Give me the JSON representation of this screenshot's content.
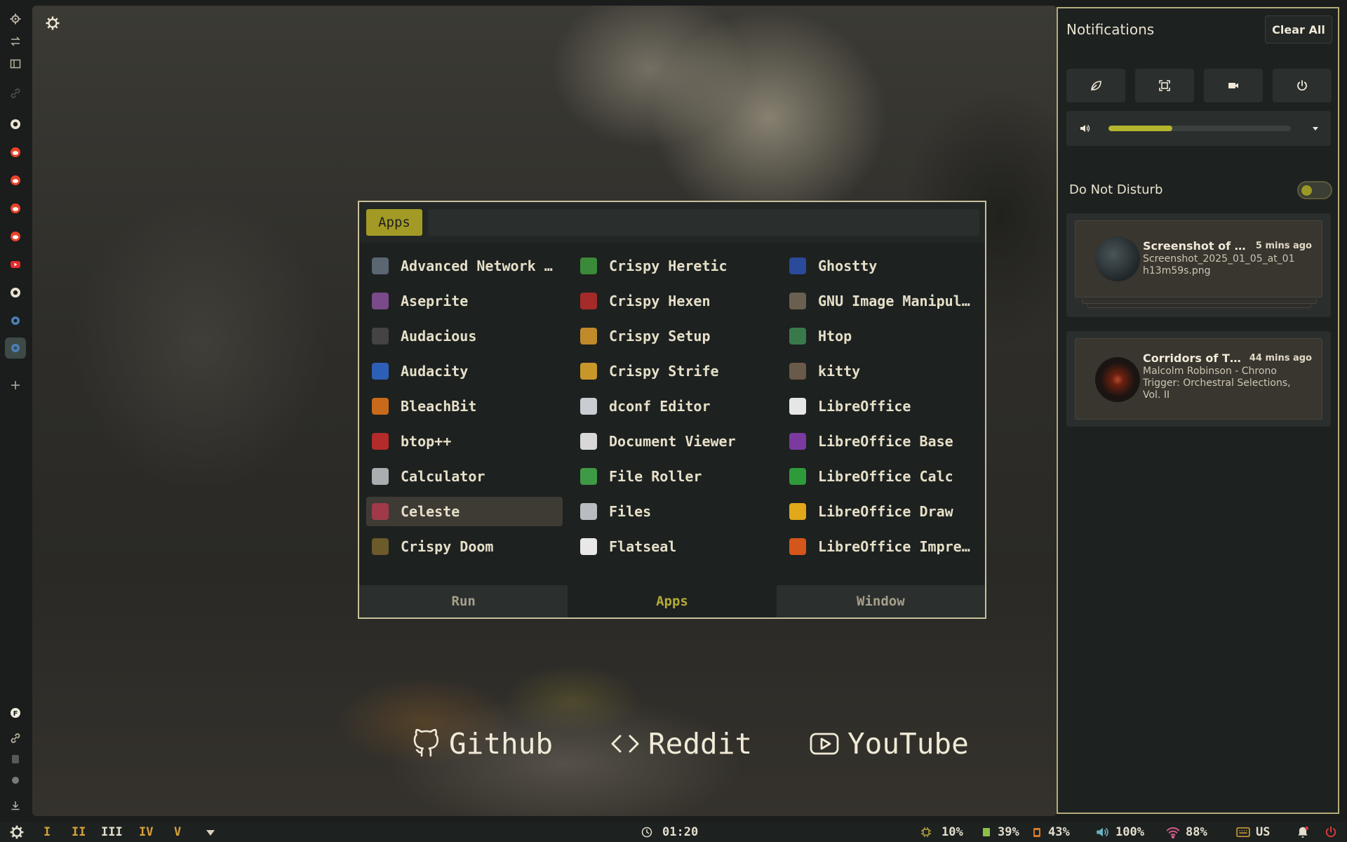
{
  "launcher": {
    "mode": "Apps",
    "search_value": "",
    "apps": [
      {
        "label": "Advanced Network …",
        "icon": "network-settings-icon",
        "color": "#5b6673"
      },
      {
        "label": "Aseprite",
        "icon": "aseprite-icon",
        "color": "#7b4a8a"
      },
      {
        "label": "Audacious",
        "icon": "audacious-icon",
        "color": "#444"
      },
      {
        "label": "Audacity",
        "icon": "audacity-icon",
        "color": "#2e5fb8"
      },
      {
        "label": "BleachBit",
        "icon": "bleachbit-icon",
        "color": "#c86a1a"
      },
      {
        "label": "btop++",
        "icon": "btop-icon",
        "color": "#b32b2b"
      },
      {
        "label": "Calculator",
        "icon": "calculator-icon",
        "color": "#a9aeb0"
      },
      {
        "label": "Celeste",
        "icon": "celeste-icon",
        "color": "#a03a4a"
      },
      {
        "label": "Crispy Doom",
        "icon": "crispy-doom-icon",
        "color": "#6b5a2a"
      },
      {
        "label": "Crispy Heretic",
        "icon": "crispy-heretic-icon",
        "color": "#3a8a3a"
      },
      {
        "label": "Crispy Hexen",
        "icon": "crispy-hexen-icon",
        "color": "#a52a2a"
      },
      {
        "label": "Crispy Setup",
        "icon": "crispy-setup-icon",
        "color": "#c08a2a"
      },
      {
        "label": "Crispy Strife",
        "icon": "crispy-strife-icon",
        "color": "#c9962a"
      },
      {
        "label": "dconf Editor",
        "icon": "dconf-editor-icon",
        "color": "#c9cdd1"
      },
      {
        "label": "Document Viewer",
        "icon": "document-viewer-icon",
        "color": "#d8d8d8"
      },
      {
        "label": "File Roller",
        "icon": "file-roller-icon",
        "color": "#3f9a45"
      },
      {
        "label": "Files",
        "icon": "files-icon",
        "color": "#b7bcc1"
      },
      {
        "label": "Flatseal",
        "icon": "flatseal-icon",
        "color": "#e8e8e8"
      },
      {
        "label": "Ghostty",
        "icon": "ghostty-icon",
        "color": "#2a4a9a"
      },
      {
        "label": "GNU Image Manipul…",
        "icon": "gimp-icon",
        "color": "#6b6050"
      },
      {
        "label": "Htop",
        "icon": "htop-icon",
        "color": "#3a7a4a"
      },
      {
        "label": "kitty",
        "icon": "kitty-icon",
        "color": "#6a5a4a"
      },
      {
        "label": "LibreOffice",
        "icon": "libreoffice-icon",
        "color": "#e6e6e6"
      },
      {
        "label": "LibreOffice Base",
        "icon": "libreoffice-base-icon",
        "color": "#7a3aa0"
      },
      {
        "label": "LibreOffice Calc",
        "icon": "libreoffice-calc-icon",
        "color": "#2f9a3a"
      },
      {
        "label": "LibreOffice Draw",
        "icon": "libreoffice-draw-icon",
        "color": "#e0a81a"
      },
      {
        "label": "LibreOffice Impre…",
        "icon": "libreoffice-impress-icon",
        "color": "#d4561a"
      }
    ],
    "selected_index": 7,
    "tabs": [
      {
        "label": "Run",
        "active": false
      },
      {
        "label": "Apps",
        "active": true
      },
      {
        "label": "Window",
        "active": false
      }
    ]
  },
  "quick_links": [
    {
      "label": "Github",
      "icon": "github-icon"
    },
    {
      "label": "Reddit",
      "icon": "code-icon"
    },
    {
      "label": "YouTube",
      "icon": "youtube-icon"
    }
  ],
  "notifications": {
    "title": "Notifications",
    "clear_label": "Clear All",
    "quick_buttons": [
      "leaf-icon",
      "screenshot-icon",
      "record-icon",
      "power-icon"
    ],
    "volume": {
      "icon": "volume-icon",
      "fraction": 0.35,
      "menu_icon": "chevron-down-icon"
    },
    "dnd_label": "Do Not Disturb",
    "dnd_on": false,
    "items": [
      {
        "title": "Screenshot of …",
        "time": "5 mins ago",
        "body": "Screenshot_2025_01_05_at_01 h13m59s.png"
      },
      {
        "title": "Corridors of T…",
        "time": "44 mins ago",
        "body": "Malcolm Robinson - Chrono Trigger: Orchestral Selections, Vol. II"
      }
    ]
  },
  "bottom_bar": {
    "workspaces": [
      "I",
      "II",
      "III",
      "IV",
      "V"
    ],
    "active_workspace": 2,
    "clock": "01:20",
    "cpu": "10%",
    "memory": "39%",
    "battery": "43%",
    "volume": "100%",
    "wifi": "88%",
    "keyboard_layout": "US"
  },
  "colors": {
    "accent": "#a39a25",
    "panel_border": "#c9c19c",
    "workspace": "#d7a23a",
    "alert": "#d23a3a"
  }
}
